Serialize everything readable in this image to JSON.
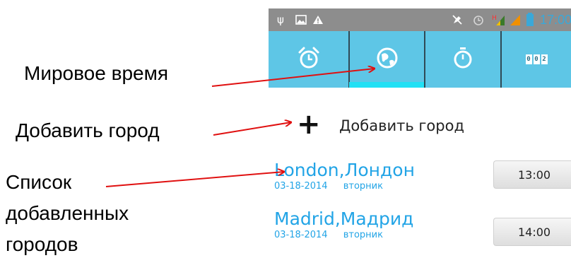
{
  "status_bar": {
    "time": "17:00",
    "icons": [
      "usb-icon",
      "image-icon",
      "warning-icon",
      "mute-icon",
      "alarm-icon",
      "signal-h-icon",
      "signal-icon",
      "battery-icon"
    ]
  },
  "tabs": [
    {
      "name": "alarm-clock-icon",
      "active": false
    },
    {
      "name": "world-clock-icon",
      "active": true
    },
    {
      "name": "stopwatch-icon",
      "active": false
    },
    {
      "name": "timer-icon",
      "active": false
    }
  ],
  "timer_tab_digits": "002",
  "add_city": {
    "plus": "+",
    "label": "Добавить город"
  },
  "cities": [
    {
      "name": "London,Лондон",
      "date": "03-18-2014",
      "weekday": "вторник",
      "time": "13:00"
    },
    {
      "name": "Madrid,Мадрид",
      "date": "03-18-2014",
      "weekday": "вторник",
      "time": "14:00"
    }
  ],
  "captions": {
    "world_time": "Мировое время",
    "add_city": "Добавить город",
    "list_line1": "Список",
    "list_line2": "добавленных",
    "list_line3": "городов"
  },
  "colors": {
    "status_bar_bg": "#8d8d8d",
    "tab_bar_bg": "#5ec6e6",
    "tab_indicator": "#21e0f4",
    "city_text": "#22a4e6",
    "arrow": "#e01010"
  }
}
